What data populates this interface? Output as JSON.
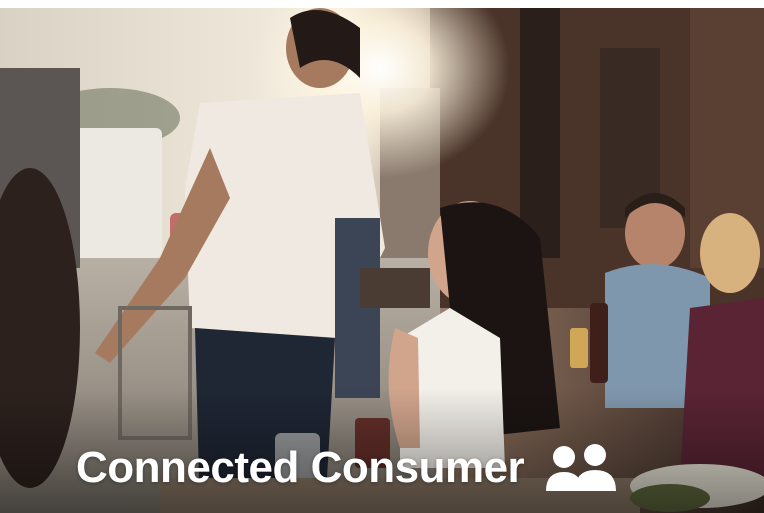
{
  "scene": {
    "caption": "Connected Consumer",
    "icon": "people-icon",
    "text_color": "#ffffff"
  }
}
